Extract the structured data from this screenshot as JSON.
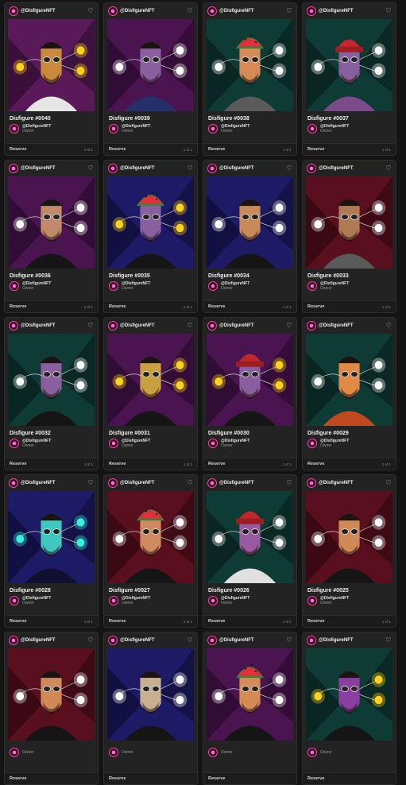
{
  "owner_role_label": "Owner",
  "reserve_label": "Reserve",
  "cards": [
    {
      "handle": "@DisfigureNFT",
      "title": "Disfigure #0040",
      "owner": "@DisfigureNFT",
      "edition": "1 of 1",
      "bg": "#5a1a5a",
      "skin": "#c98a3c",
      "light": "#ffd21e",
      "hat": "none",
      "shirt": "#e5e5e5"
    },
    {
      "handle": "@DisfigureNFT",
      "title": "Disfigure #0039",
      "owner": "@DisfigureNFT",
      "edition": "1 of 1",
      "bg": "#4a1450",
      "skin": "#8a5fa0",
      "light": "#ffffff",
      "hat": "none",
      "shirt": "#23306a"
    },
    {
      "handle": "@DisfigureNFT",
      "title": "Disfigure #0038",
      "owner": "@DisfigureNFT",
      "edition": "1 of 1",
      "bg": "#0f3b35",
      "skin": "#d68a55",
      "light": "#ffffff",
      "hat": "watermelon",
      "shirt": "#5a5a5a"
    },
    {
      "handle": "@DisfigureNFT",
      "title": "Disfigure #0037",
      "owner": "@DisfigureNFT",
      "edition": "1 of 1",
      "bg": "#0f3b35",
      "skin": "#8a5fa0",
      "light": "#ffffff",
      "hat": "beanie",
      "shirt": "#7a4a8a"
    },
    {
      "handle": "@DisfigureNFT",
      "title": "Disfigure #0036",
      "owner": "@DisfigureNFT",
      "edition": "1 of 1",
      "bg": "#4a1450",
      "skin": "#c08a6a",
      "light": "#ffffff",
      "hat": "none",
      "shirt": "#151515"
    },
    {
      "handle": "@DisfigureNFT",
      "title": "Disfigure #0035",
      "owner": "@DisfigureNFT",
      "edition": "1 of 1",
      "bg": "#1d1a66",
      "skin": "#8a5fa0",
      "light": "#ffd21e",
      "hat": "watermelon",
      "shirt": "#151515"
    },
    {
      "handle": "@DisfigureNFT",
      "title": "Disfigure #0034",
      "owner": "@DisfigureNFT",
      "edition": "1 of 1",
      "bg": "#1d1a66",
      "skin": "#c98a5a",
      "light": "#ffffff",
      "hat": "none",
      "shirt": "#151515"
    },
    {
      "handle": "@DisfigureNFT",
      "title": "Disfigure #0033",
      "owner": "@DisfigureNFT",
      "edition": "1 of 1",
      "bg": "#5a0f1e",
      "skin": "#b07a55",
      "light": "#ffffff",
      "hat": "none",
      "shirt": "#5a5a5a"
    },
    {
      "handle": "@DisfigureNFT",
      "title": "Disfigure #0032",
      "owner": "@DisfigureNFT",
      "edition": "1 of 1",
      "bg": "#0f3b35",
      "skin": "#8a5fa0",
      "light": "#ffffff",
      "hat": "none",
      "shirt": "#151515"
    },
    {
      "handle": "@DisfigureNFT",
      "title": "Disfigure #0031",
      "owner": "@DisfigureNFT",
      "edition": "1 of 1",
      "bg": "#4a1450",
      "skin": "#c9a040",
      "light": "#ffd21e",
      "hat": "none",
      "shirt": "#151515"
    },
    {
      "handle": "@DisfigureNFT",
      "title": "Disfigure #0030",
      "owner": "@DisfigureNFT",
      "edition": "1 of 1",
      "bg": "#4a1450",
      "skin": "#8a5fa0",
      "light": "#ffd21e",
      "hat": "beanie",
      "shirt": "#151515"
    },
    {
      "handle": "@DisfigureNFT",
      "title": "Disfigure #0029",
      "owner": "@DisfigureNFT",
      "edition": "1 of 1",
      "bg": "#0f3b35",
      "skin": "#e08a45",
      "light": "#ffffff",
      "hat": "none",
      "shirt": "#c04a20"
    },
    {
      "handle": "@DisfigureNFT",
      "title": "Disfigure #0028",
      "owner": "@DisfigureNFT",
      "edition": "1 of 1",
      "bg": "#1d1a66",
      "skin": "#3fc7c0",
      "light": "#38f0e0",
      "hat": "none",
      "shirt": "#101030"
    },
    {
      "handle": "@DisfigureNFT",
      "title": "Disfigure #0027",
      "owner": "@DisfigureNFT",
      "edition": "1 of 1",
      "bg": "#5a0f1e",
      "skin": "#d08a60",
      "light": "#ffffff",
      "hat": "watermelon",
      "shirt": "#151515"
    },
    {
      "handle": "@DisfigureNFT",
      "title": "Disfigure #0026",
      "owner": "@DisfigureNFT",
      "edition": "1 of 1",
      "bg": "#0f3b35",
      "skin": "#9a5aa0",
      "light": "#ffffff",
      "hat": "beanie",
      "shirt": "#e0e0e0"
    },
    {
      "handle": "@DisfigureNFT",
      "title": "Disfigure #0025",
      "owner": "@DisfigureNFT",
      "edition": "1 of 1",
      "bg": "#5a0f1e",
      "skin": "#d08a55",
      "light": "#ffffff",
      "hat": "none",
      "shirt": "#151515"
    },
    {
      "handle": "@DisfigureNFT",
      "title": "",
      "owner": "",
      "edition": "",
      "bg": "#5a0f1e",
      "skin": "#d08a55",
      "light": "#ffffff",
      "hat": "none",
      "shirt": "#151515"
    },
    {
      "handle": "@DisfigureNFT",
      "title": "",
      "owner": "",
      "edition": "",
      "bg": "#1d1a66",
      "skin": "#c9b090",
      "light": "#ffffff",
      "hat": "none",
      "shirt": "#151515"
    },
    {
      "handle": "@DisfigureNFT",
      "title": "",
      "owner": "",
      "edition": "",
      "bg": "#4a1450",
      "skin": "#d68a55",
      "light": "#ffffff",
      "hat": "watermelon",
      "shirt": "#151515"
    },
    {
      "handle": "@DisfigureNFT",
      "title": "",
      "owner": "",
      "edition": "",
      "bg": "#0f3b35",
      "skin": "#8a3fa0",
      "light": "#ffd21e",
      "hat": "none",
      "shirt": "#151515"
    }
  ]
}
